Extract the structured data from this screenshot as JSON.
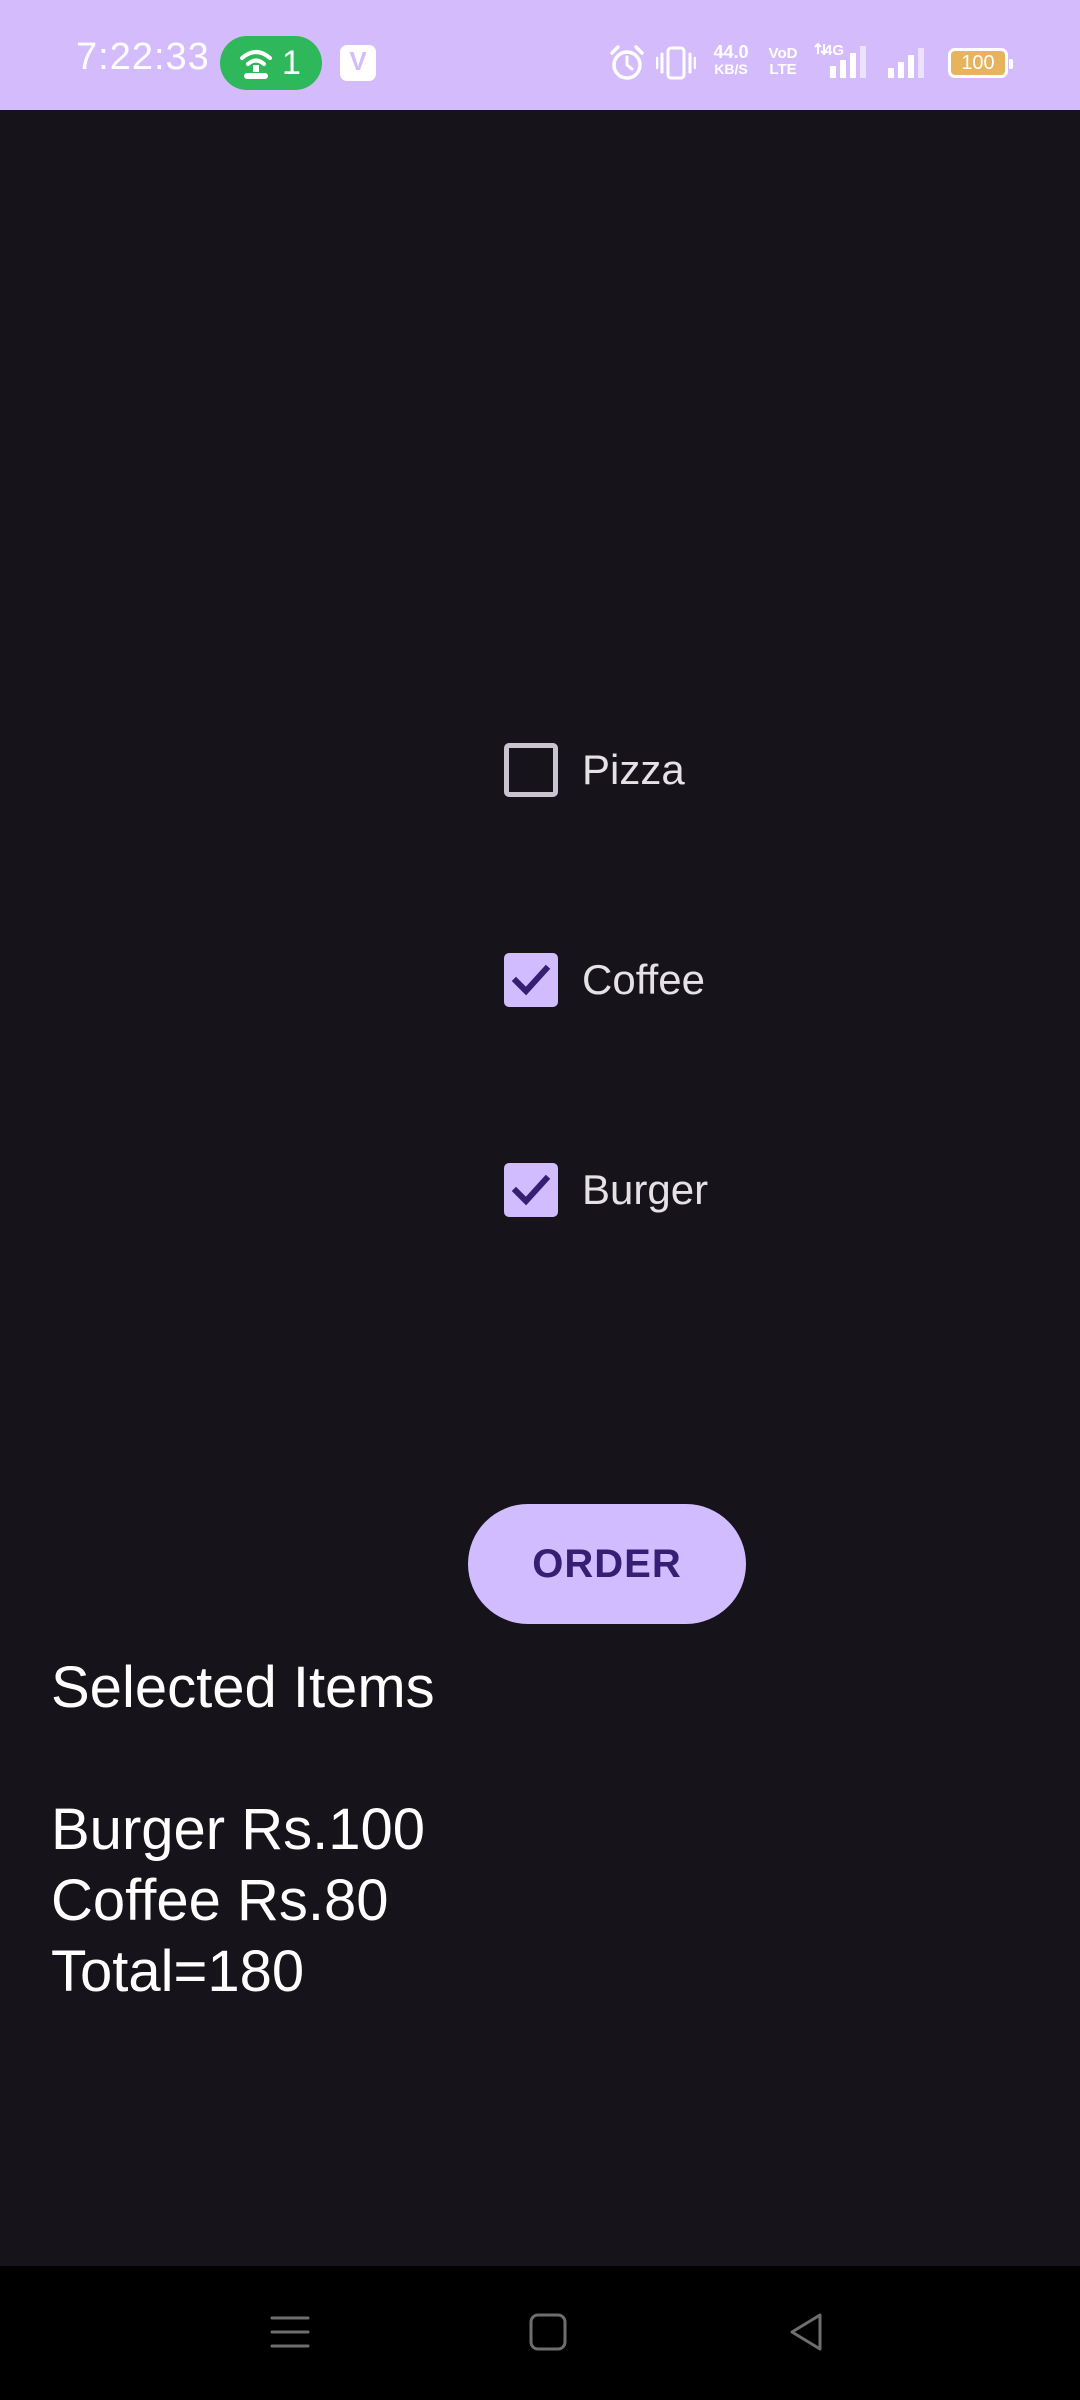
{
  "status_bar": {
    "time": "7:22:33",
    "hotspot_count": "1",
    "vpn_letter": "V",
    "net_speed_value": "44.0",
    "net_speed_unit": "KB/S",
    "volte_top": "VoD",
    "volte_bottom": "LTE",
    "network_type": "4G",
    "battery_level": "100",
    "background_color": "#d4bcfc"
  },
  "options": [
    {
      "label": "Pizza",
      "checked": false
    },
    {
      "label": "Coffee",
      "checked": true
    },
    {
      "label": "Burger",
      "checked": true
    }
  ],
  "order_button": {
    "label": "ORDER"
  },
  "result": {
    "heading": "Selected Items",
    "lines": [
      "Burger Rs.100",
      "Coffee Rs.80",
      "Total=180"
    ]
  },
  "colors": {
    "background": "#16141a",
    "accent": "#d0bcff",
    "on_accent": "#381e72"
  },
  "nav_bar": {
    "icons": [
      "menu-icon",
      "home-icon",
      "back-icon"
    ]
  }
}
